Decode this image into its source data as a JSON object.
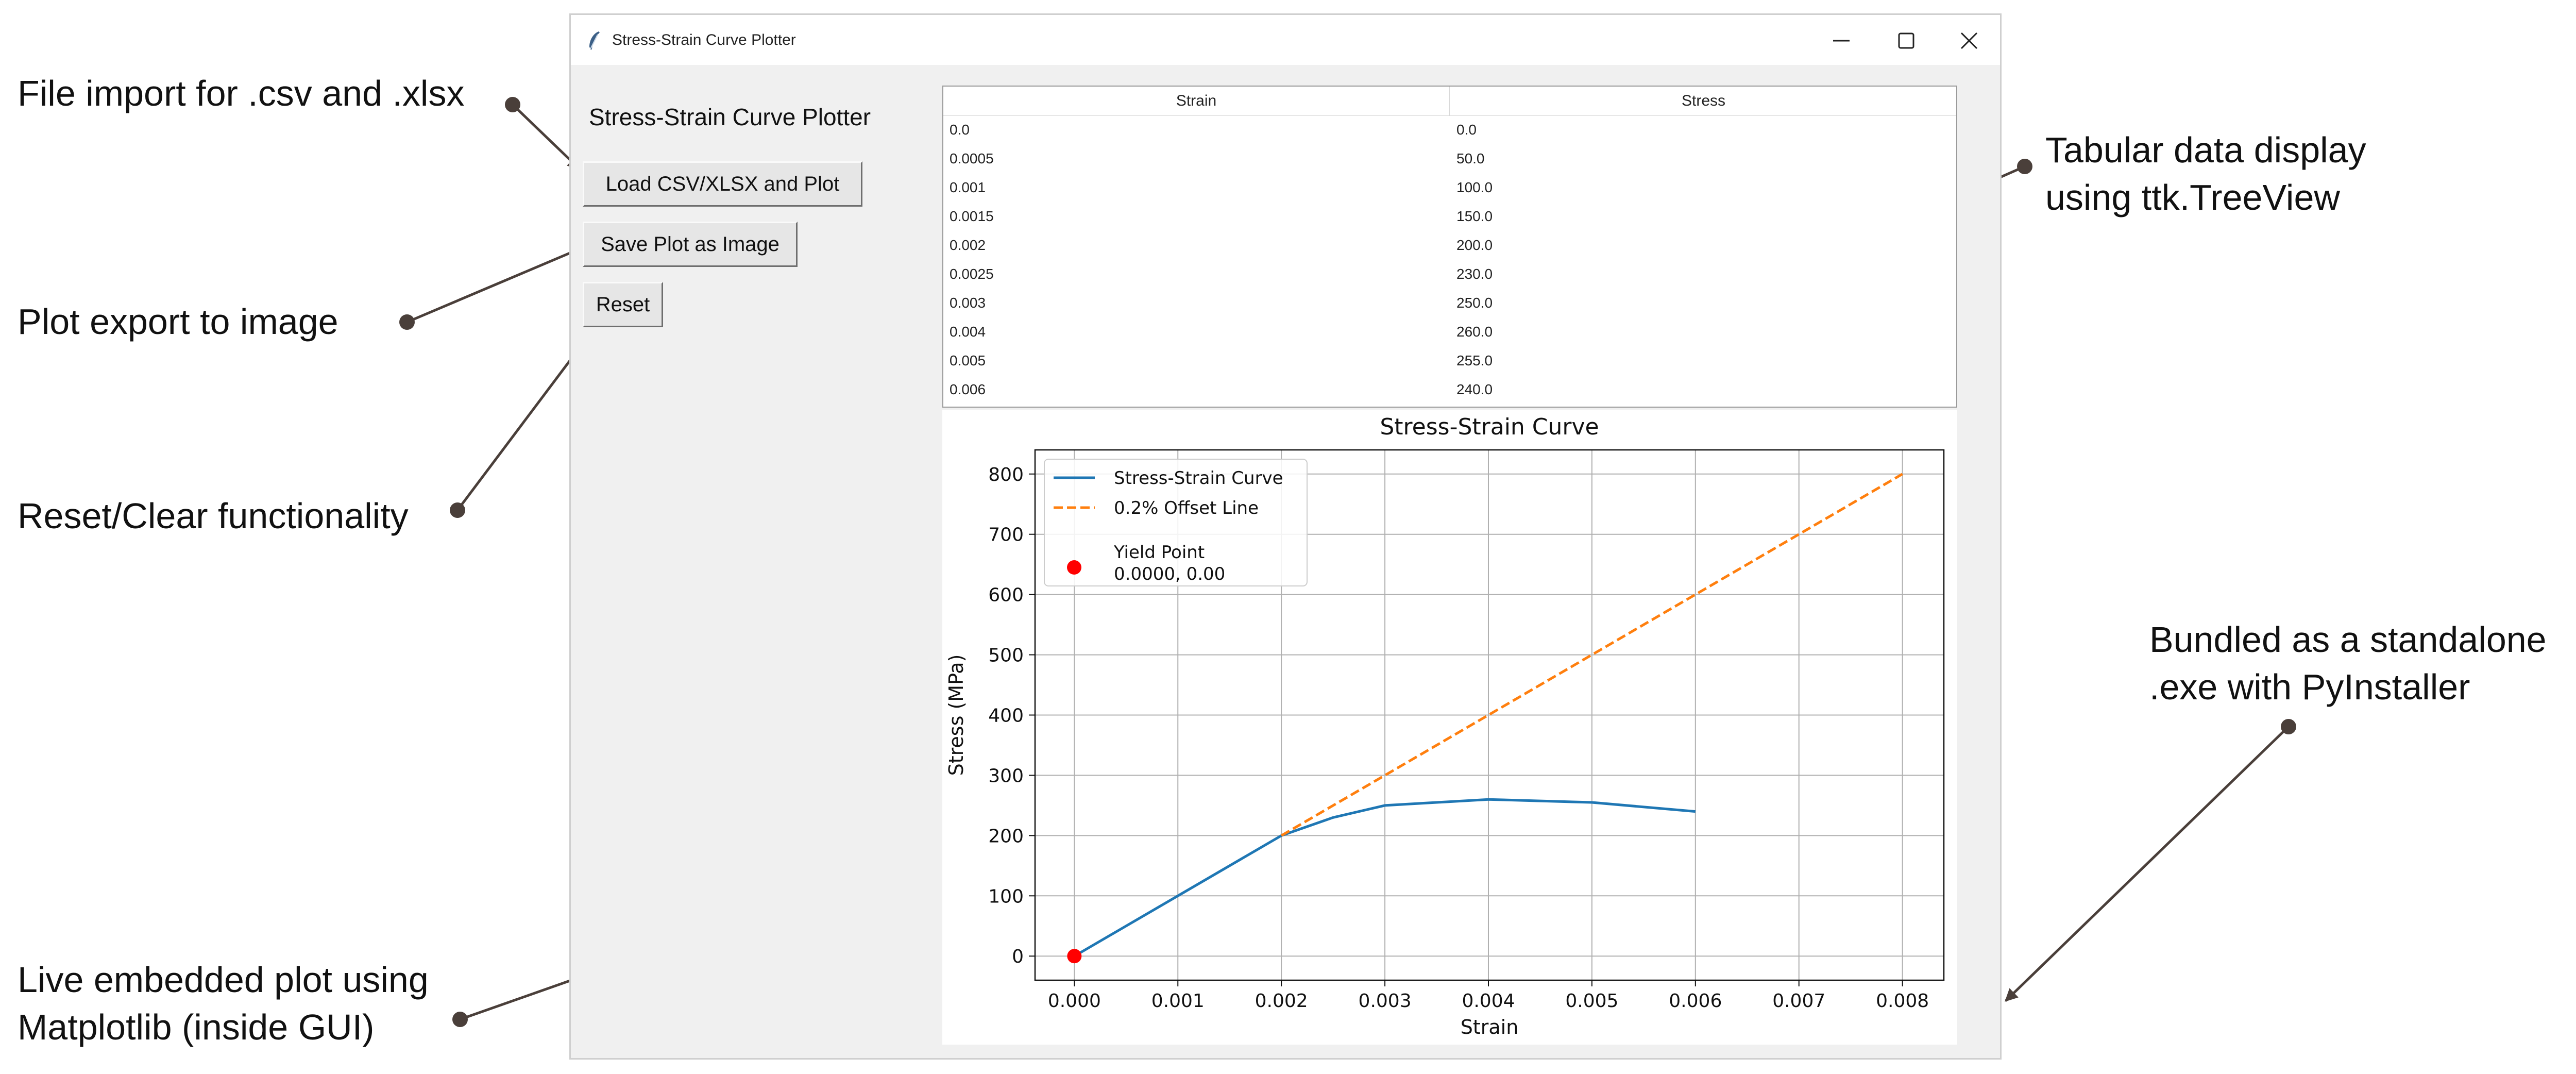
{
  "window": {
    "title": "Stress-Strain Curve Plotter",
    "controls": [
      "minimize-icon",
      "maximize-icon",
      "close-icon"
    ]
  },
  "app": {
    "heading": "Stress-Strain Curve Plotter",
    "buttons": {
      "load": "Load CSV/XLSX and Plot",
      "save": "Save Plot as Image",
      "reset": "Reset"
    }
  },
  "table": {
    "columns": [
      "Strain",
      "Stress"
    ],
    "rows": [
      [
        "0.0",
        "0.0"
      ],
      [
        "0.0005",
        "50.0"
      ],
      [
        "0.001",
        "100.0"
      ],
      [
        "0.0015",
        "150.0"
      ],
      [
        "0.002",
        "200.0"
      ],
      [
        "0.0025",
        "230.0"
      ],
      [
        "0.003",
        "250.0"
      ],
      [
        "0.004",
        "260.0"
      ],
      [
        "0.005",
        "255.0"
      ],
      [
        "0.006",
        "240.0"
      ]
    ]
  },
  "annotations": {
    "file_import": "File import for .csv and .xlsx",
    "plot_export": "Plot export to image",
    "reset_clear": "Reset/Clear functionality",
    "live_plot_line1": "Live embedded plot using",
    "live_plot_line2": "Matplotlib (inside GUI)",
    "tabular_line1": "Tabular data display",
    "tabular_line2": "using ttk.TreeView",
    "bundled_line1": "Bundled as a standalone",
    "bundled_line2": ".exe with PyInstaller"
  },
  "colors": {
    "curve": "#1f77b4",
    "offset": "#ff7f0e",
    "yield": "#ff0000",
    "arrow": "#4a3f3a"
  },
  "chart_data": {
    "type": "line",
    "title": "Stress-Strain Curve",
    "xlabel": "Strain",
    "ylabel": "Stress (MPa)",
    "xlim": [
      -0.00038,
      0.0084
    ],
    "ylim": [
      -40,
      840
    ],
    "xticks": [
      0.0,
      0.001,
      0.002,
      0.003,
      0.004,
      0.005,
      0.006,
      0.007,
      0.008
    ],
    "xtick_labels": [
      "0.000",
      "0.001",
      "0.002",
      "0.003",
      "0.004",
      "0.005",
      "0.006",
      "0.007",
      "0.008"
    ],
    "yticks": [
      0,
      100,
      200,
      300,
      400,
      500,
      600,
      700,
      800
    ],
    "ytick_labels": [
      "0",
      "100",
      "200",
      "300",
      "400",
      "500",
      "600",
      "700",
      "800"
    ],
    "grid": true,
    "legend_position": "top-left",
    "series": [
      {
        "name": "Stress-Strain Curve",
        "style": "solid",
        "color": "#1f77b4",
        "x": [
          0.0,
          0.0005,
          0.001,
          0.0015,
          0.002,
          0.0025,
          0.003,
          0.004,
          0.005,
          0.006
        ],
        "y": [
          0,
          50,
          100,
          150,
          200,
          230,
          250,
          260,
          255,
          240
        ]
      },
      {
        "name": "0.2% Offset Line",
        "style": "dashed",
        "color": "#ff7f0e",
        "x": [
          0.002,
          0.008
        ],
        "y": [
          200,
          800
        ]
      },
      {
        "name": "Yield Point",
        "label_line2": "0.0000, 0.00",
        "style": "marker",
        "color": "#ff0000",
        "x": [
          0.0
        ],
        "y": [
          0
        ]
      }
    ]
  }
}
